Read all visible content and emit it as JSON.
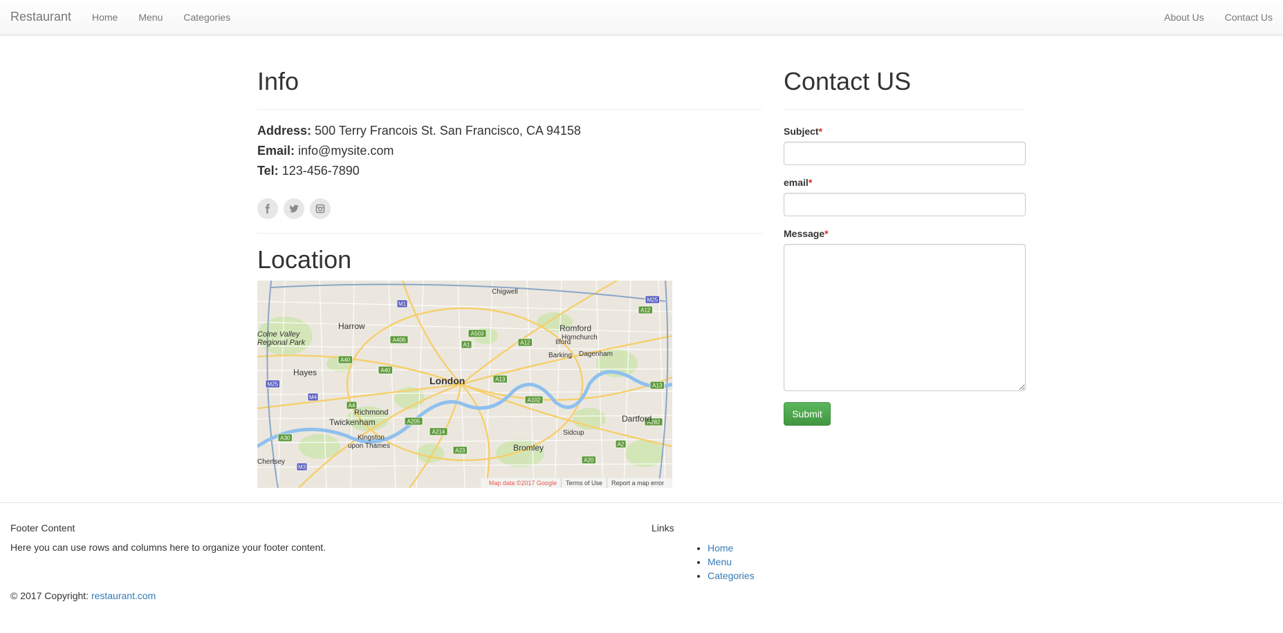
{
  "navbar": {
    "brand": "Restaurant",
    "left_links": [
      "Home",
      "Menu",
      "Categories"
    ],
    "right_links": [
      "About Us",
      "Contact Us"
    ]
  },
  "info": {
    "title": "Info",
    "address_label": "Address:",
    "address_value": "500 Terry Francois St. San Francisco, CA 94158",
    "email_label": "Email:",
    "email_value": "info@mysite.com",
    "tel_label": "Tel:",
    "tel_value": "123-456-7890",
    "social_icons": [
      "facebook-icon",
      "twitter-icon",
      "instagram-icon"
    ]
  },
  "location": {
    "title": "Location",
    "map_labels": [
      "Chigwell",
      "Harrow",
      "Romford",
      "Hornchurch",
      "Colne Valley",
      "Regional Park",
      "Ilford",
      "Barking",
      "Dagenham",
      "Hayes",
      "London",
      "Richmond",
      "Twickenham",
      "Dartford",
      "Sidcup",
      "Kingston",
      "upon Thames",
      "Bromley",
      "Chertsey"
    ],
    "road_badges": [
      "M1",
      "M25",
      "A12",
      "A503",
      "A406",
      "A1",
      "A12",
      "A40",
      "A40",
      "M25",
      "A13",
      "M4",
      "A13",
      "A4",
      "A102",
      "A205",
      "A282",
      "A214",
      "A30",
      "A2",
      "A23",
      "A20",
      "M3"
    ],
    "footer": {
      "data": "Map data ©2017 Google",
      "terms": "Terms of Use",
      "report": "Report a map error"
    }
  },
  "contact": {
    "title": "Contact US",
    "subject_label": "Subject",
    "email_label": "email",
    "message_label": "Message",
    "required_mark": "*",
    "subject_value": "",
    "email_value": "",
    "message_value": "",
    "submit_label": "Submit"
  },
  "footer": {
    "content_title": "Footer Content",
    "content_text": "Here you can use rows and columns here to organize your footer content.",
    "links_title": "Links",
    "links": [
      "Home",
      "Menu",
      "Categories"
    ],
    "copyright_prefix": "© 2017 Copyright: ",
    "copyright_link": "restaurant.com"
  },
  "colors": {
    "link": "#337ab7",
    "submit": "#449d44",
    "required": "#e5251e"
  }
}
